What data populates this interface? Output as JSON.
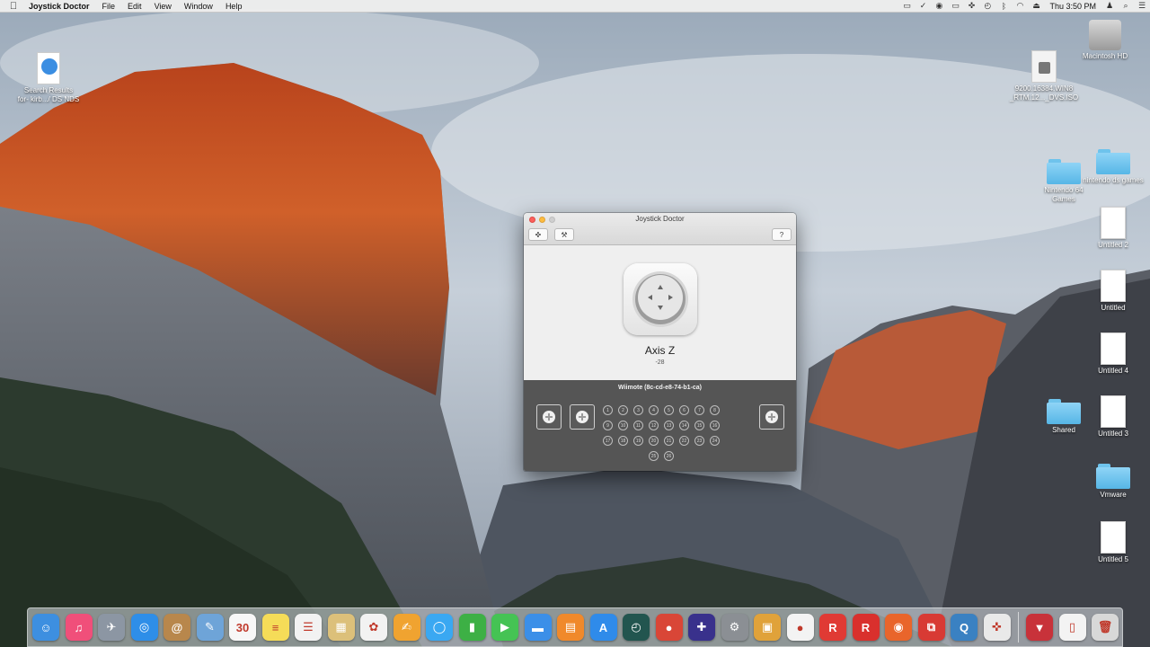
{
  "menubar": {
    "apple_icon": "apple-logo-icon",
    "app_name": "Joystick Doctor",
    "items": [
      "File",
      "Edit",
      "View",
      "Window",
      "Help"
    ],
    "status_icons": [
      "screen-share-icon",
      "checkmark-icon",
      "record-icon",
      "airplay-icon",
      "joystick-icon",
      "time-machine-icon",
      "bluetooth-icon",
      "wifi-icon",
      "eject-icon"
    ],
    "clock": "Thu 3:50 PM",
    "trailing_icons": [
      "user-icon",
      "spotlight-icon",
      "notification-center-icon"
    ]
  },
  "desktop": {
    "icons": [
      {
        "label": "Search Results\nfor- kirb.../ DS NDS",
        "type": "webloc"
      },
      {
        "label": "Macintosh HD",
        "type": "drive"
      },
      {
        "label": "9200.16384.WIN8\n_RTM.12..._DVS.ISO",
        "type": "disk-image"
      },
      {
        "label": "Nintendo 64\nGames",
        "type": "folder"
      },
      {
        "label": "nintendo ds games",
        "type": "folder"
      },
      {
        "label": "Untitled 2",
        "type": "document"
      },
      {
        "label": "Untitled",
        "type": "document"
      },
      {
        "label": "Untitled 4",
        "type": "document"
      },
      {
        "label": "Shared",
        "type": "folder"
      },
      {
        "label": "Untitled 3",
        "type": "document"
      },
      {
        "label": "Vmware",
        "type": "folder"
      },
      {
        "label": "Untitled 5",
        "type": "document"
      }
    ]
  },
  "window": {
    "title": "Joystick Doctor",
    "toolbar": {
      "controller_icon": "gamepad-icon",
      "tools_icon": "tools-icon",
      "help_icon": "help-icon"
    },
    "axis": {
      "name": "Axis Z",
      "value": "-28"
    },
    "device": {
      "name": "Wiimote (8c-cd-e8-74-b1-ca)",
      "buttons": [
        "1",
        "2",
        "3",
        "4",
        "5",
        "6",
        "7",
        "8",
        "9",
        "10",
        "11",
        "12",
        "13",
        "14",
        "15",
        "16",
        "17",
        "18",
        "19",
        "20",
        "21",
        "22",
        "23",
        "24",
        "25",
        "26"
      ]
    }
  },
  "dock": {
    "apps": [
      {
        "name": "finder-icon",
        "glyph": "☺",
        "color": "#3d8fe0"
      },
      {
        "name": "itunes-icon",
        "glyph": "♫",
        "color": "#f04f7a"
      },
      {
        "name": "launchpad-icon",
        "glyph": "✈",
        "color": "#8c96a3"
      },
      {
        "name": "safari-icon",
        "glyph": "◎",
        "color": "#2e8ee8"
      },
      {
        "name": "contacts-icon",
        "glyph": "@",
        "color": "#b8874c"
      },
      {
        "name": "preview-icon",
        "glyph": "✎",
        "color": "#6ea4d8"
      },
      {
        "name": "calendar-icon",
        "glyph": "30",
        "color": "#f7f7f7"
      },
      {
        "name": "notes-icon",
        "glyph": "≡",
        "color": "#f5dc58"
      },
      {
        "name": "reminders-icon",
        "glyph": "☰",
        "color": "#f2f2f2"
      },
      {
        "name": "photos-slideshow-icon",
        "glyph": "▦",
        "color": "#dcc07a"
      },
      {
        "name": "photos-icon",
        "glyph": "✿",
        "color": "#f2f2f2"
      },
      {
        "name": "pages-icon",
        "glyph": "✍",
        "color": "#f0a330"
      },
      {
        "name": "messages-icon",
        "glyph": "◯",
        "color": "#3aa8f2"
      },
      {
        "name": "numbers-icon",
        "glyph": "▮",
        "color": "#3db045"
      },
      {
        "name": "facetime-icon",
        "glyph": "▶",
        "color": "#45c354"
      },
      {
        "name": "keynote-icon",
        "glyph": "▬",
        "color": "#3b8fe8"
      },
      {
        "name": "ibooks-icon",
        "glyph": "▤",
        "color": "#f0892b"
      },
      {
        "name": "app-store-icon",
        "glyph": "A",
        "color": "#2f8bea"
      },
      {
        "name": "time-machine-icon",
        "glyph": "◴",
        "color": "#22554f"
      },
      {
        "name": "chrome-icon",
        "glyph": "●",
        "color": "#d94637"
      },
      {
        "name": "joystick-doctor-icon",
        "glyph": "✚",
        "color": "#39318c"
      },
      {
        "name": "system-preferences-icon",
        "glyph": "⚙",
        "color": "#8b8f94"
      },
      {
        "name": "photo-booth-icon",
        "glyph": "▣",
        "color": "#e0a23a"
      },
      {
        "name": "game-center-icon",
        "glyph": "●",
        "color": "#f3f3f3"
      },
      {
        "name": "roblox-icon",
        "glyph": "R",
        "color": "#e03a34"
      },
      {
        "name": "roblox-studio-icon",
        "glyph": "R",
        "color": "#d9302d"
      },
      {
        "name": "firefox-icon",
        "glyph": "◉",
        "color": "#e9652b"
      },
      {
        "name": "parallels-icon",
        "glyph": "⧉",
        "color": "#d83a34"
      },
      {
        "name": "quicktime-icon",
        "glyph": "Q",
        "color": "#3a81c2"
      },
      {
        "name": "controller-icon",
        "glyph": "✜",
        "color": "#e9e9e9"
      }
    ],
    "right_items": [
      {
        "name": "downloads-stack-icon",
        "glyph": "▼",
        "color": "#c8323a"
      },
      {
        "name": "document-stack-icon",
        "glyph": "▯",
        "color": "#f3f3f3"
      },
      {
        "name": "trash-icon",
        "glyph": "🗑",
        "color": "#d8d8d8"
      }
    ]
  }
}
